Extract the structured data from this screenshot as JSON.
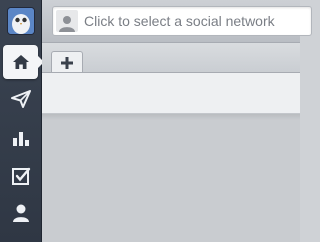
{
  "app": {
    "sidebar": {
      "avatar_icon": "user-avatar",
      "items": [
        {
          "icon": "home-icon",
          "active": true
        },
        {
          "icon": "send-icon",
          "active": false
        },
        {
          "icon": "analytics-icon",
          "active": false
        },
        {
          "icon": "assignments-icon",
          "active": false
        },
        {
          "icon": "contacts-icon",
          "active": false
        }
      ]
    },
    "topbar": {
      "network_selector_text": "Click to select a social network"
    },
    "tabs": {
      "add_tab_icon": "plus-icon"
    },
    "colors": {
      "sidebar": "#343d4b",
      "active_item": "#f4f5f7",
      "icon_light": "#eef1f5",
      "icon_dark": "#333a46"
    }
  }
}
